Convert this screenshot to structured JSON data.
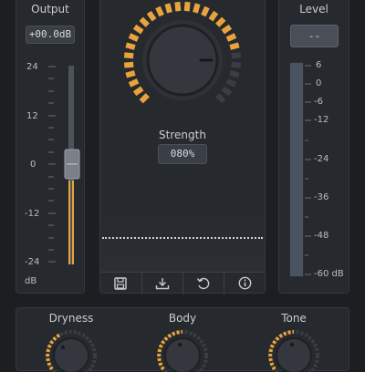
{
  "output": {
    "title": "Output",
    "readout": "+00.0dB",
    "scale": [
      "24",
      "12",
      "0",
      "-12",
      "-24"
    ],
    "unit": "dB"
  },
  "strength": {
    "label": "Strength",
    "readout": "080%",
    "value_percent": 80
  },
  "level": {
    "title": "Level",
    "readout": "--",
    "scale": [
      "6",
      "0",
      "-6",
      "-12",
      "-24",
      "-36",
      "-48",
      "-60 dB"
    ]
  },
  "toolbar": {
    "icons": [
      "save-icon",
      "download-icon",
      "reset-icon",
      "info-icon"
    ]
  },
  "knobs": [
    {
      "label": "Dryness"
    },
    {
      "label": "Body"
    },
    {
      "label": "Tone"
    }
  ],
  "colors": {
    "accent": "#e8a33c",
    "background": "#1c1e22",
    "panel": "#26292e",
    "lcd": "#3a3e45"
  }
}
